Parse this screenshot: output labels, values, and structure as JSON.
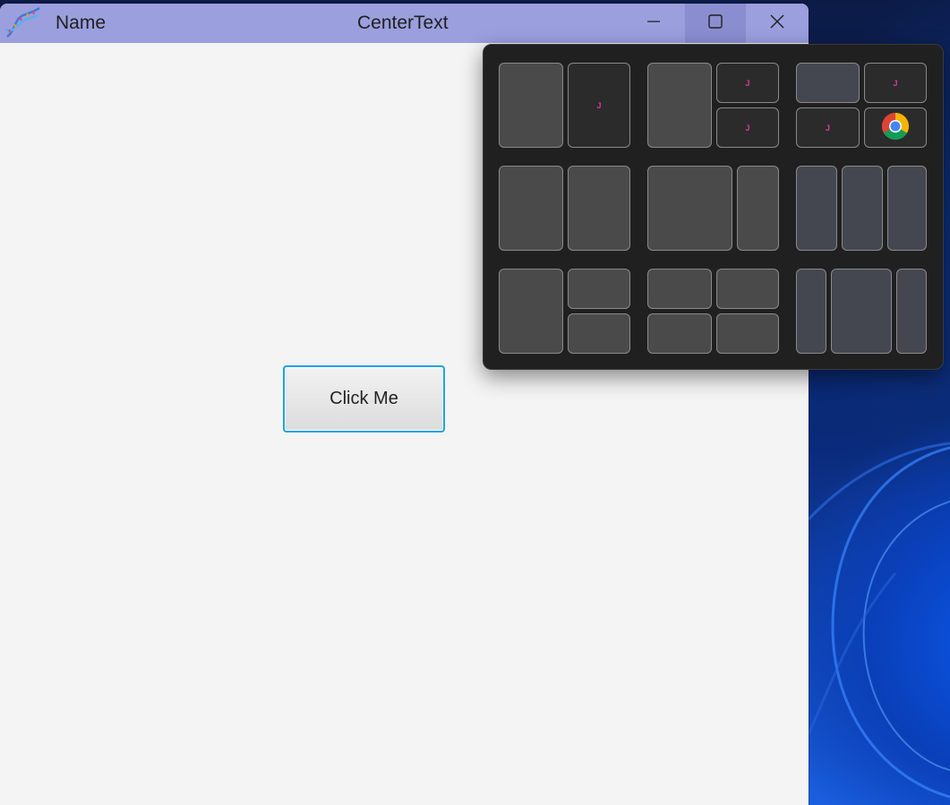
{
  "window": {
    "name_label": "Name",
    "title": "CenterText",
    "app_icon": "dna-helix-icon"
  },
  "caption_buttons": {
    "minimize_icon": "minimize-icon",
    "maximize_icon": "maximize-icon",
    "close_icon": "close-icon"
  },
  "main": {
    "button_label": "Click Me"
  },
  "snap_flyout": {
    "window_glyph": "J",
    "browser_icon": "chrome-icon"
  },
  "colors": {
    "titlebar": "#9b9fde",
    "button_focus_border": "#1aa3e8",
    "flyout_bg": "#202020",
    "java_glyph": "#e0389a"
  }
}
